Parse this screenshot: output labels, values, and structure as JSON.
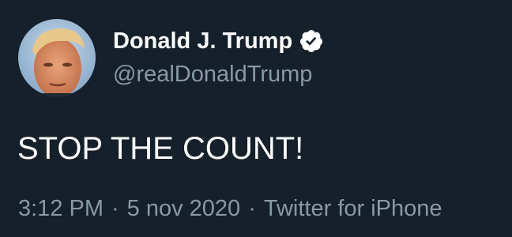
{
  "author": {
    "display_name": "Donald J. Trump",
    "handle": "@realDonaldTrump",
    "verified": true,
    "verified_icon": "verified-badge-icon"
  },
  "tweet": {
    "text": "STOP THE COUNT!"
  },
  "meta": {
    "time": "3:12 PM",
    "separator": "·",
    "date": "5 nov 2020",
    "source": "Twitter for iPhone"
  },
  "colors": {
    "background": "#15202b",
    "primary_text": "#ffffff",
    "secondary_text": "#8899a6"
  }
}
